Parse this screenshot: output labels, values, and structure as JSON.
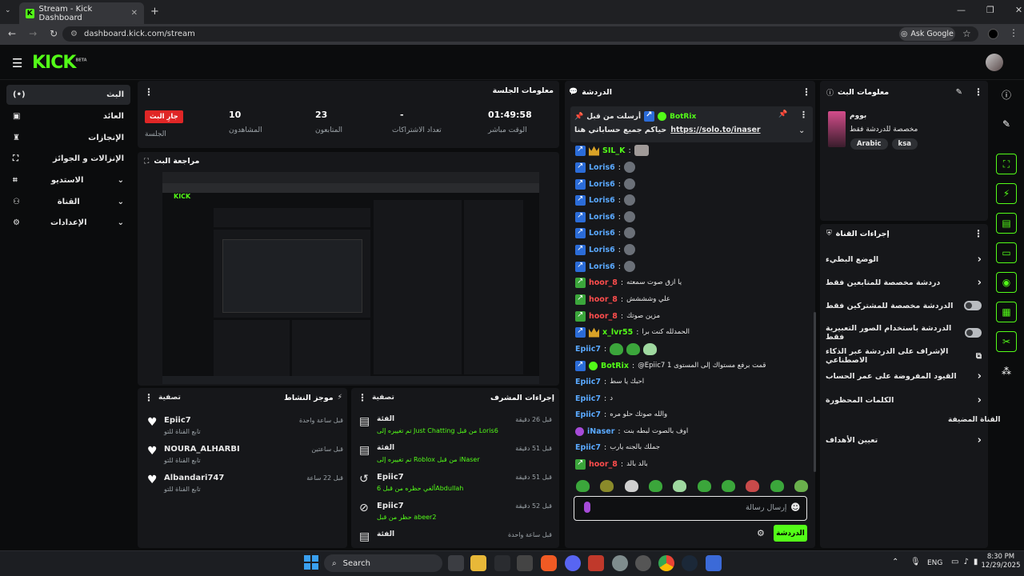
{
  "browser": {
    "tab_title": "Stream - Kick Dashboard",
    "url": "dashboard.kick.com/stream",
    "ask_google": "Ask Google"
  },
  "site": {
    "logo": "KICK",
    "logo_badge": "BETA"
  },
  "sidebar": {
    "items": [
      {
        "label": "البث",
        "icon": "broadcast-icon"
      },
      {
        "label": "العائد",
        "icon": "wallet-icon"
      },
      {
        "label": "الإنجازات",
        "icon": "trophy-icon"
      },
      {
        "label": "الإنزالات و الجوائز",
        "icon": "drops-icon"
      },
      {
        "label": "الاستديو",
        "icon": "studio-icon"
      },
      {
        "label": "القناة",
        "icon": "channel-icon"
      },
      {
        "label": "الإعدادات",
        "icon": "gear-icon"
      }
    ]
  },
  "session": {
    "title": "معلومات الجلسة",
    "live_badge": "جارِ البث",
    "session_label": "الجلسة",
    "viewers": "10",
    "viewers_label": "المشاهدون",
    "followers": "23",
    "followers_label": "المتابعون",
    "subs": "-",
    "subs_label": "تعداد الاشتراكات",
    "uptime": "01:49:58",
    "uptime_label": "الوقت مباشر"
  },
  "preview": {
    "title": "مراجعة البث"
  },
  "activity": {
    "title": "موجز النشاط",
    "filter": "تصفية",
    "items": [
      {
        "name": "Epiic7",
        "action": "تابع القناة للتو",
        "time": "قبل ساعة واحدة"
      },
      {
        "name": "NOURA_ALHARBI",
        "action": "تابع القناة للتو",
        "time": "قبل ساعتين"
      },
      {
        "name": "Albandari747",
        "action": "تابع القناة للتو",
        "time": "قبل 22 ساعة"
      }
    ]
  },
  "modlog": {
    "title": "إجراءات المشرف",
    "filter": "تصفية",
    "items": [
      {
        "title": "الفئة",
        "detail": "تم تغييره إلى Just Chatting من قبل Loris6",
        "time": "قبل 26 دقيقة",
        "icon": "category-icon"
      },
      {
        "title": "الفئة",
        "detail": "تم تغييره إلى Roblox من قبل iNaser",
        "time": "قبل 51 دقيقة",
        "icon": "category-icon"
      },
      {
        "title": "Epiic7",
        "detail": "ألغي حظره من قبل 6Abdullah",
        "time": "قبل 51 دقيقة",
        "icon": "undo-icon"
      },
      {
        "title": "Epiic7",
        "detail": "حظر من قبل abeer2",
        "time": "قبل 52 دقيقة",
        "icon": "ban-icon"
      },
      {
        "title": "الفئة",
        "detail": "",
        "time": "قبل ساعة واحدة",
        "icon": "category-icon"
      }
    ]
  },
  "chat": {
    "title": "الدردشة",
    "pinned_by": "أرسلت من قبل",
    "pinned_user": "BotRix",
    "pinned_text": "حياكم جميع حساباتي هنا",
    "pinned_link": "https://solo.to/inaser",
    "messages": [
      {
        "user": "SIL_K",
        "text": "",
        "color": "#53fc18"
      },
      {
        "user": "Loris6",
        "text": "",
        "color": "#5aa9ff"
      },
      {
        "user": "Loris6",
        "text": "",
        "color": "#5aa9ff"
      },
      {
        "user": "Loris6",
        "text": "",
        "color": "#5aa9ff"
      },
      {
        "user": "Loris6",
        "text": "",
        "color": "#5aa9ff"
      },
      {
        "user": "Loris6",
        "text": "",
        "color": "#5aa9ff"
      },
      {
        "user": "Loris6",
        "text": "",
        "color": "#5aa9ff"
      },
      {
        "user": "Loris6",
        "text": "",
        "color": "#5aa9ff"
      },
      {
        "user": "hoor_8",
        "text": "يا ازق صوت سمعته",
        "color": "#ff4d4d"
      },
      {
        "user": "hoor_8",
        "text": "علي وشششش",
        "color": "#ff4d4d"
      },
      {
        "user": "hoor_8",
        "text": "مزين صوتك",
        "color": "#ff4d4d"
      },
      {
        "user": "x_lvr55",
        "text": "الحمدلله كنت برا",
        "color": "#53fc18"
      },
      {
        "user": "Epiic7",
        "text": "",
        "color": "#5aa9ff"
      },
      {
        "user": "BotRix",
        "text": "@Epiic7 قمت برفع مستواك إلى المستوى 1",
        "color": "#53fc18"
      },
      {
        "user": "Epiic7",
        "text": "احبك يا سط",
        "color": "#5aa9ff"
      },
      {
        "user": "Epiic7",
        "text": "د",
        "color": "#5aa9ff"
      },
      {
        "user": "Epiic7",
        "text": "والله صوتك حلو مره",
        "color": "#5aa9ff"
      },
      {
        "user": "iNaser",
        "text": "اوف بالصوت لبطه بنت",
        "color": "#5aa9ff"
      },
      {
        "user": "Epiic7",
        "text": "جملك بالجنه يارب",
        "color": "#5aa9ff"
      },
      {
        "user": "hoor_8",
        "text": "بالد بالد",
        "color": "#ff4d4d"
      }
    ],
    "input_placeholder": "إرسال رسالة",
    "send_label": "الدردشة"
  },
  "stream_info": {
    "title": "معلومات البث",
    "stream_title": "بووم",
    "desc": "مخصصة للدردشة فقط",
    "tags": [
      "Arabic",
      "ksa"
    ]
  },
  "channel_actions": {
    "title": "إجراءات القناة",
    "items": [
      {
        "label": "الوضع البطيء",
        "type": "arrow"
      },
      {
        "label": "دردشة مخصصة للمتابعين فقط",
        "type": "arrow"
      },
      {
        "label": "الدردشة مخصصة للمشتركين فقط",
        "type": "toggle"
      },
      {
        "label": "الدردشة باستخدام الصور التعبيرية فقط",
        "type": "toggle"
      },
      {
        "label": "الإشراف على الدردشة عبر الذكاء الاصطناعي",
        "type": "external"
      },
      {
        "label": "القيود المفروضة على عمر الحساب",
        "type": "arrow"
      },
      {
        "label": "الكلمات المحظورة",
        "type": "arrow"
      }
    ],
    "section2": "القناة المضيفة",
    "goals": "تعيين الأهداف"
  },
  "taskbar": {
    "search": "Search",
    "lang": "ENG",
    "time": "8:30 PM",
    "date": "12/29/2025"
  }
}
